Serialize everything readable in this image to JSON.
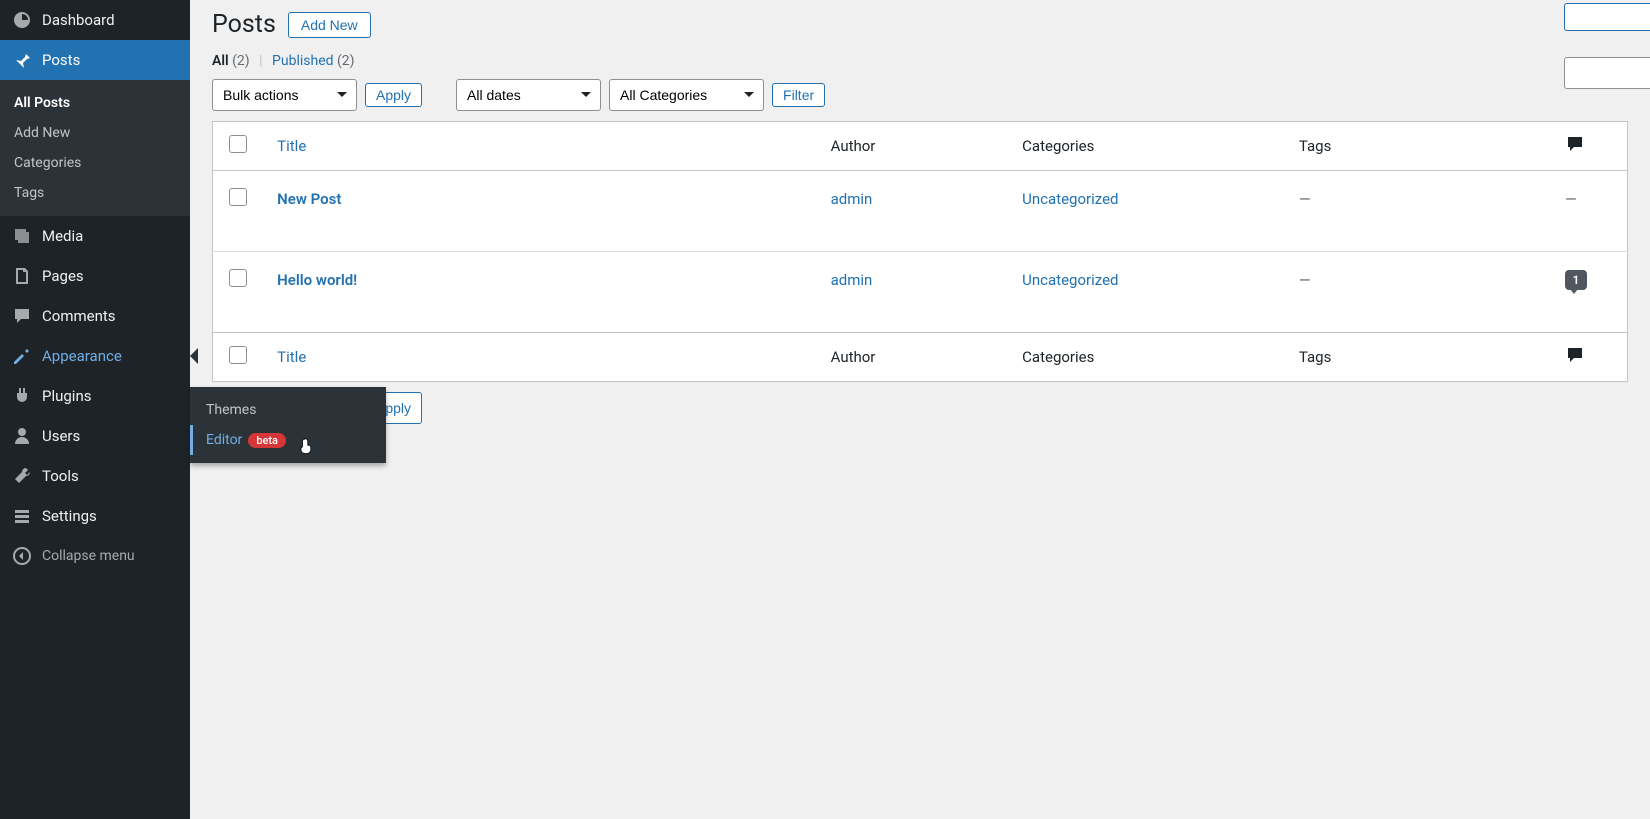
{
  "sidebar": {
    "dashboard": "Dashboard",
    "posts": "Posts",
    "posts_submenu": {
      "all": "All Posts",
      "addnew": "Add New",
      "categories": "Categories",
      "tags": "Tags"
    },
    "media": "Media",
    "pages": "Pages",
    "comments": "Comments",
    "appearance": "Appearance",
    "appearance_submenu": {
      "themes": "Themes",
      "editor": "Editor",
      "editor_badge": "beta"
    },
    "plugins": "Plugins",
    "users": "Users",
    "tools": "Tools",
    "settings": "Settings",
    "collapse": "Collapse menu"
  },
  "header": {
    "page_title": "Posts",
    "add_new": "Add New"
  },
  "subsubsub": {
    "all_label": "All",
    "all_count": "(2)",
    "published_label": "Published",
    "published_count": "(2)"
  },
  "filters": {
    "bulk_actions": "Bulk actions",
    "apply": "Apply",
    "all_dates": "All dates",
    "all_categories": "All Categories",
    "filter": "Filter"
  },
  "table": {
    "cols": {
      "title": "Title",
      "author": "Author",
      "categories": "Categories",
      "tags": "Tags"
    },
    "rows": [
      {
        "title": "New Post",
        "author": "admin",
        "categories": "Uncategorized",
        "tags": "—",
        "comments": "—"
      },
      {
        "title": "Hello world!",
        "author": "admin",
        "categories": "Uncategorized",
        "tags": "—",
        "comments": "1"
      }
    ]
  }
}
